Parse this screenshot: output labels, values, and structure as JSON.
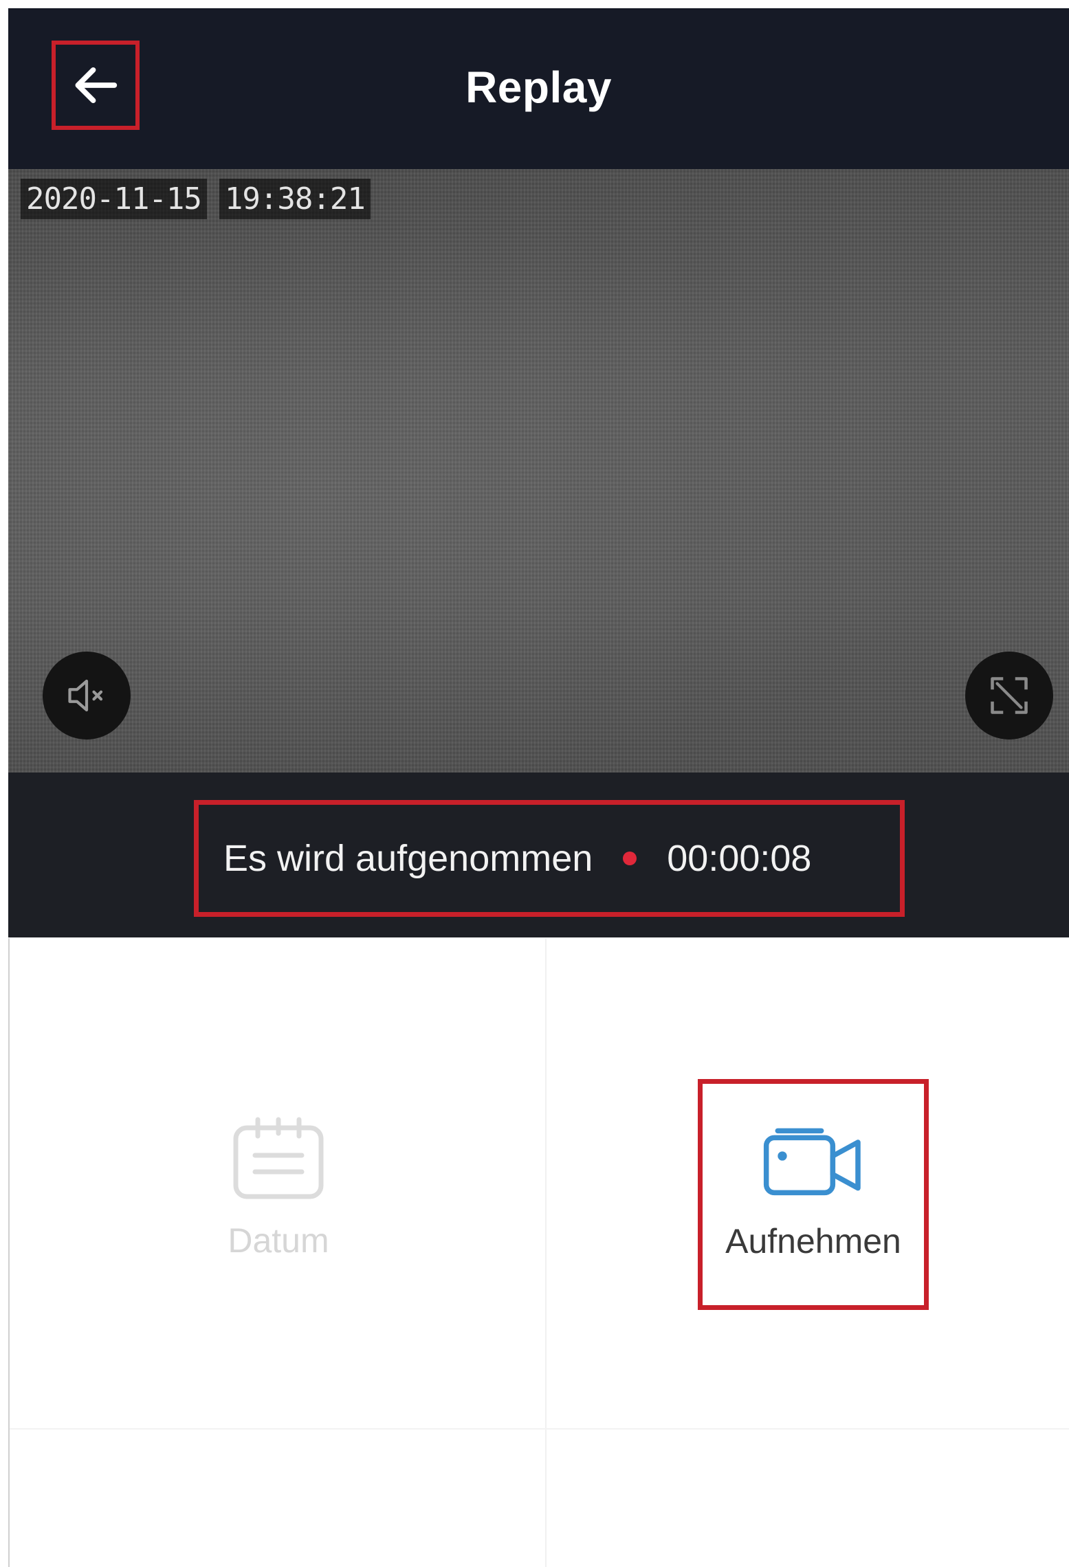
{
  "header": {
    "title": "Replay",
    "back_icon": "arrow-left-icon"
  },
  "video": {
    "osd_date": "2020-11-15",
    "osd_time": "19:38:21",
    "mute_icon": "speaker-muted-icon",
    "fullscreen_icon": "fullscreen-icon"
  },
  "recording": {
    "status_text": "Es wird aufgenommen",
    "elapsed": "00:00:08",
    "dot_color": "#e0283a"
  },
  "actions": {
    "date_label": "Datum",
    "date_icon": "calendar-icon",
    "record_label": "Aufnehmen",
    "record_icon": "video-camera-icon",
    "record_icon_color": "#3a8fd0"
  },
  "colors": {
    "header_bg": "#161a26",
    "highlight": "#c8202a"
  }
}
